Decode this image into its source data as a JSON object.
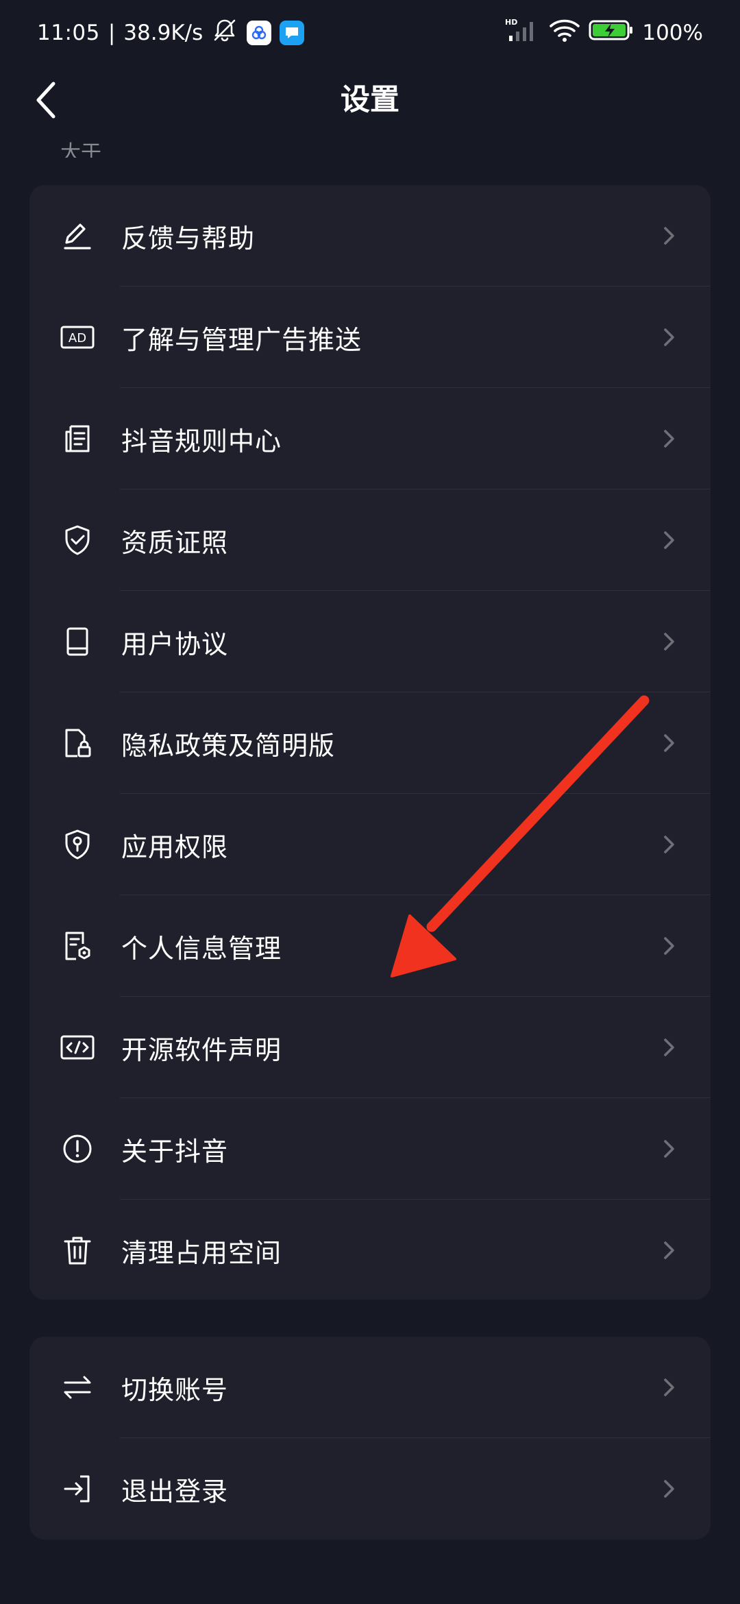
{
  "status_bar": {
    "time": "11:05",
    "separator": "|",
    "net_speed": "38.9K/s",
    "network_badge": "HD",
    "battery_percent": "100%",
    "icons": [
      "bell-muted-icon",
      "baidu-app-icon",
      "messenger-app-icon",
      "signal-icon",
      "wifi-icon",
      "battery-charging-icon"
    ]
  },
  "header": {
    "title": "设置",
    "back_icon": "chevron-left-icon"
  },
  "partial_section_label": "大于",
  "menu_main": [
    {
      "label": "反馈与帮助",
      "icon": "edit-pen-icon"
    },
    {
      "label": "了解与管理广告推送",
      "icon": "ad-icon"
    },
    {
      "label": "抖音规则中心",
      "icon": "document-list-icon"
    },
    {
      "label": "资质证照",
      "icon": "shield-check-icon"
    },
    {
      "label": "用户协议",
      "icon": "book-icon"
    },
    {
      "label": "隐私政策及简明版",
      "icon": "file-lock-icon"
    },
    {
      "label": "应用权限",
      "icon": "shield-key-icon"
    },
    {
      "label": "个人信息管理",
      "icon": "file-gear-icon"
    },
    {
      "label": "开源软件声明",
      "icon": "code-icon"
    },
    {
      "label": "关于抖音",
      "icon": "info-circle-icon"
    },
    {
      "label": "清理占用空间",
      "icon": "trash-icon"
    }
  ],
  "menu_account": [
    {
      "label": "切换账号",
      "icon": "swap-arrows-icon"
    },
    {
      "label": "退出登录",
      "icon": "logout-icon"
    }
  ],
  "colors": {
    "background": "#161823",
    "card": "#1f202b",
    "divider": "#2e2f3a",
    "text": "#ffffff",
    "muted": "#8a8b91",
    "annotation_arrow": "#f0321e",
    "battery_green": "#3ccd37"
  },
  "annotation": {
    "type": "arrow",
    "points_to": "个人信息管理"
  }
}
